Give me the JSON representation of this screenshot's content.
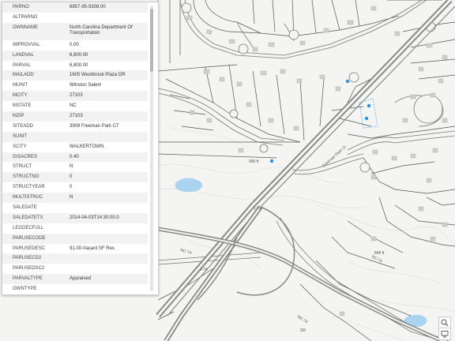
{
  "attributes": [
    {
      "key": "PARNO",
      "value": "6857-95-9308.00"
    },
    {
      "key": "ALTPARNO",
      "value": ""
    },
    {
      "key": "OWNNAME",
      "value": "North Carolina Department Of Transportation"
    },
    {
      "key": "IMPROVVAL",
      "value": "0.00"
    },
    {
      "key": "LANDVAL",
      "value": "6,800.00"
    },
    {
      "key": "PARVAL",
      "value": "6,800.00"
    },
    {
      "key": "MAILADD",
      "value": "1605 Westbrook Plaza DR"
    },
    {
      "key": "MUNIT",
      "value": "Winston Salem"
    },
    {
      "key": "MCITY",
      "value": "27103"
    },
    {
      "key": "MSTATE",
      "value": "NC"
    },
    {
      "key": "MZIP",
      "value": "27103"
    },
    {
      "key": "SITEADD",
      "value": "3909 Freeman Park CT"
    },
    {
      "key": "SUNIT",
      "value": ""
    },
    {
      "key": "SCITY",
      "value": "WALKERTOWN"
    },
    {
      "key": "GISACRES",
      "value": "0.40"
    },
    {
      "key": "STRUCT",
      "value": "N"
    },
    {
      "key": "STRUCTNO",
      "value": "0"
    },
    {
      "key": "STRUCTYEAR",
      "value": "0"
    },
    {
      "key": "MULTISTRUC",
      "value": "N"
    },
    {
      "key": "SALEDATE",
      "value": ""
    },
    {
      "key": "SALEDATETX",
      "value": "2014-04-03T14:30:00.0"
    },
    {
      "key": "LEGDECFULL",
      "value": ""
    },
    {
      "key": "PARUSECODE",
      "value": ""
    },
    {
      "key": "PARUSEDESC",
      "value": "91.00-Vacant SF Res"
    },
    {
      "key": "PARUSECD2",
      "value": ""
    },
    {
      "key": "PARUSEDSC2",
      "value": ""
    },
    {
      "key": "PARVALTYPE",
      "value": "Appraised"
    },
    {
      "key": "OWNTYPE",
      "value": ""
    }
  ],
  "map": {
    "street_labels": {
      "freeman_park": "Freeman Park Ct",
      "nc74_a": "NC-74",
      "nc74_b": "NC-74",
      "nc74_c": "NC-74",
      "i74_a": "I-74",
      "i74_b": "I-74",
      "sr": "SR",
      "spot_a": "900 ft",
      "spot_b": "849 ft"
    },
    "colors": {
      "background": "#f4f4f2",
      "parcel_line": "#555555",
      "building": "#cfcfcf",
      "highway": "#7d7d7d",
      "water": "#a9d3ef",
      "point_marker": "#2f8fdc"
    }
  },
  "controls": {
    "zoom_icon": "zoom-icon",
    "monitor_icon": "monitor-icon"
  }
}
